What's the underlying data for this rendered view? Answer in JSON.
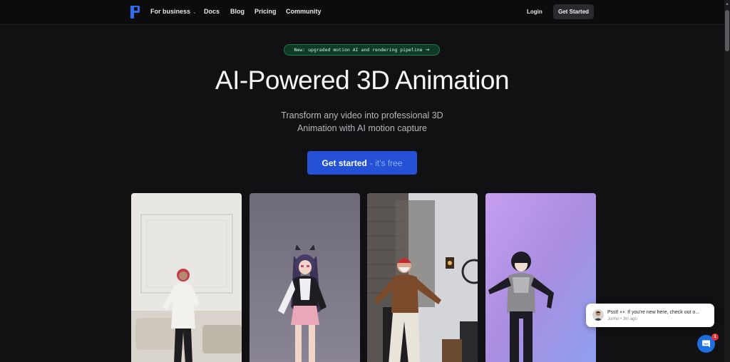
{
  "nav": {
    "links": [
      {
        "label": "For business",
        "has_dropdown": true
      },
      {
        "label": "Docs"
      },
      {
        "label": "Blog"
      },
      {
        "label": "Pricing"
      },
      {
        "label": "Community"
      }
    ],
    "login_label": "Login",
    "cta_label": "Get Started"
  },
  "hero": {
    "badge_text": "New: upgraded motion AI and rendering pipeline",
    "badge_arrow": "→",
    "title": "AI-Powered 3D Animation",
    "subtitle_line1": "Transform any video into professional 3D",
    "subtitle_line2": "Animation with AI motion capture",
    "cta_main": "Get started",
    "cta_aux": "- it's free"
  },
  "chat": {
    "message": "Psst! 👀 If you're new here, check out o...",
    "author": "Junho",
    "time": "3m ago",
    "unread_count": "1"
  },
  "colors": {
    "background": "#111113",
    "accent": "#2451d6",
    "badge_bg": "#0f3a26",
    "chat_launcher": "#1b6fe0"
  }
}
